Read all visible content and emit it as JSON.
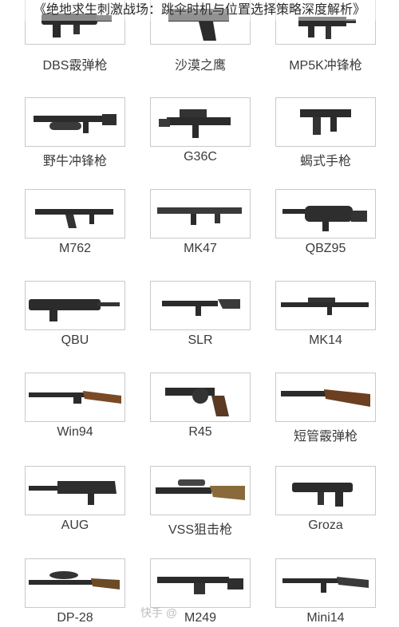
{
  "header": {
    "title": "《绝地求生刺激战场：跳伞时机与位置选择策略深度解析》"
  },
  "watermark": "快手 @",
  "weapons": [
    {
      "name": "DBS霰弹枪",
      "icon": "shotgun-bullpup-icon"
    },
    {
      "name": "沙漠之鹰",
      "icon": "pistol-icon"
    },
    {
      "name": "MP5K冲锋枪",
      "icon": "smg-icon"
    },
    {
      "name": "野牛冲锋枪",
      "icon": "smg-icon"
    },
    {
      "name": "G36C",
      "icon": "rifle-icon"
    },
    {
      "name": "蝎式手枪",
      "icon": "machine-pistol-icon"
    },
    {
      "name": "M762",
      "icon": "rifle-icon"
    },
    {
      "name": "MK47",
      "icon": "rifle-icon"
    },
    {
      "name": "QBZ95",
      "icon": "bullpup-rifle-icon"
    },
    {
      "name": "QBU",
      "icon": "dmr-icon"
    },
    {
      "name": "SLR",
      "icon": "dmr-icon"
    },
    {
      "name": "MK14",
      "icon": "dmr-icon"
    },
    {
      "name": "Win94",
      "icon": "lever-rifle-icon"
    },
    {
      "name": "R45",
      "icon": "revolver-icon"
    },
    {
      "name": "短管霰弹枪",
      "icon": "sawed-off-icon"
    },
    {
      "name": "AUG",
      "icon": "bullpup-rifle-icon"
    },
    {
      "name": "VSS狙击枪",
      "icon": "sniper-icon"
    },
    {
      "name": "Groza",
      "icon": "bullpup-rifle-icon"
    },
    {
      "name": "DP-28",
      "icon": "lmg-icon"
    },
    {
      "name": "M249",
      "icon": "lmg-icon"
    },
    {
      "name": "Mini14",
      "icon": "dmr-icon"
    }
  ]
}
